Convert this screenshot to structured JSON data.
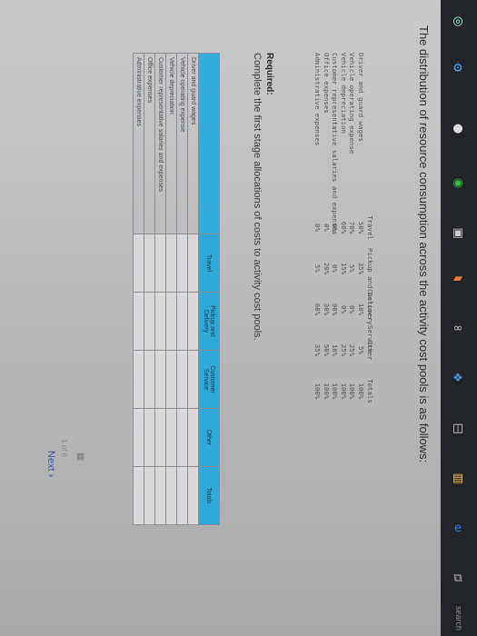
{
  "intro_text": "The distribution of resource consumption across the activity cost pools is as follows:",
  "source_table": {
    "headers": [
      "",
      "Travel",
      "Pickup and Delivery",
      "Customer Service",
      "Other",
      "Totals"
    ],
    "rows": [
      {
        "label": "Driver and guard wages",
        "values": [
          "50%",
          "35%",
          "10%",
          "5%",
          "100%"
        ]
      },
      {
        "label": "Vehicle operating expense",
        "values": [
          "70%",
          "5%",
          "0%",
          "25%",
          "100%"
        ]
      },
      {
        "label": "Vehicle depreciation",
        "values": [
          "60%",
          "15%",
          "0%",
          "25%",
          "100%"
        ]
      },
      {
        "label": "Customer representative salaries and expenses",
        "values": [
          "0%",
          "0%",
          "90%",
          "10%",
          "100%"
        ]
      },
      {
        "label": "Office expenses",
        "values": [
          "0%",
          "20%",
          "30%",
          "50%",
          "100%"
        ]
      },
      {
        "label": "Administrative expenses",
        "values": [
          "0%",
          "5%",
          "60%",
          "35%",
          "100%"
        ]
      }
    ]
  },
  "required_label": "Required:",
  "required_text": "Complete the first stage allocations of costs to activity cost pools.",
  "answer_table": {
    "headers": [
      "",
      "Travel",
      "Pickup and Delivery",
      "Customer Service",
      "Other",
      "Totals"
    ],
    "rows": [
      "Driver and guard wages",
      "Vehicle operating expense",
      "Vehicle depreciation",
      "Customer representative salaries and expenses",
      "Office expenses",
      "Administrative expenses"
    ]
  },
  "pager": "1 of 6",
  "next_label": "Next",
  "taskbar": {
    "search_text": "search"
  }
}
